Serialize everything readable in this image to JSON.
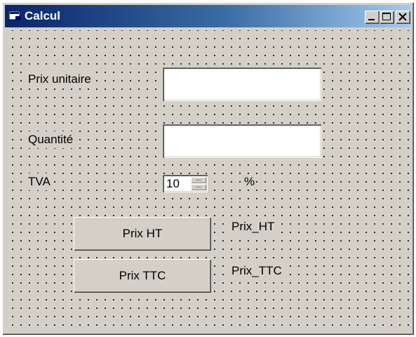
{
  "window": {
    "title": "Calcul",
    "controls": {
      "minimize": "minimize",
      "maximize": "maximize",
      "close": "close"
    }
  },
  "form": {
    "prix_unitaire_label": "Prix unitaire",
    "prix_unitaire_value": "",
    "quantite_label": "Quantité",
    "quantite_value": "",
    "tva_label": "TVA",
    "tva_value": "10",
    "percent_label": "%",
    "prix_ht_button": "Prix HT",
    "prix_ttc_button": "Prix TTC",
    "prix_ht_output": "Prix_HT",
    "prix_ttc_output": "Prix_TTC"
  },
  "colors": {
    "titlebar_start": "#0a246a",
    "titlebar_end": "#a6caf0",
    "face": "#d4d0c8"
  },
  "icons": [
    "app-icon",
    "minimize-icon",
    "maximize-icon",
    "close-icon",
    "spin-up-icon",
    "spin-down-icon"
  ]
}
